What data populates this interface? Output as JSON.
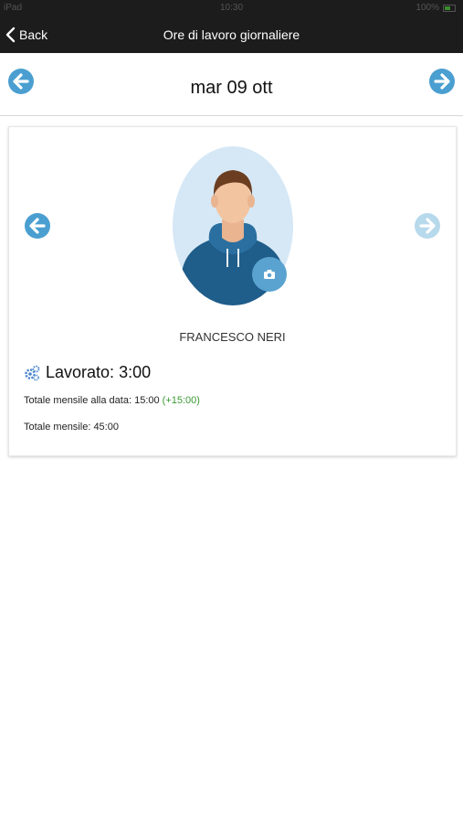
{
  "status_bar": {
    "carrier": "iPad",
    "time": "10:30",
    "battery": "100%"
  },
  "nav": {
    "back_label": "Back",
    "title": "Ore di lavoro giornaliere"
  },
  "date_bar": {
    "date": "mar 09 ott"
  },
  "employee": {
    "name": "FRANCESCO NERI",
    "worked_prefix": "Lavorato:",
    "worked_value": "3:00",
    "monthly_to_date_label": "Totale mensile alla data:",
    "monthly_to_date_value": "15:00",
    "monthly_to_date_delta": "(+15:00)",
    "monthly_total_label": "Totale mensile:",
    "monthly_total_value": "45:00"
  },
  "colors": {
    "accent": "#4a9fd0",
    "accent_disabled": "#b7d9ec",
    "positive": "#3a9a32",
    "navbar": "#1c1c1c"
  },
  "icons": {
    "back": "chevron-left-icon",
    "prev_date": "arrow-left-circle-icon",
    "next_date": "arrow-right-circle-icon",
    "prev_employee": "arrow-left-circle-icon",
    "next_employee": "arrow-right-circle-icon",
    "camera": "camera-icon",
    "worked": "gears-icon"
  }
}
